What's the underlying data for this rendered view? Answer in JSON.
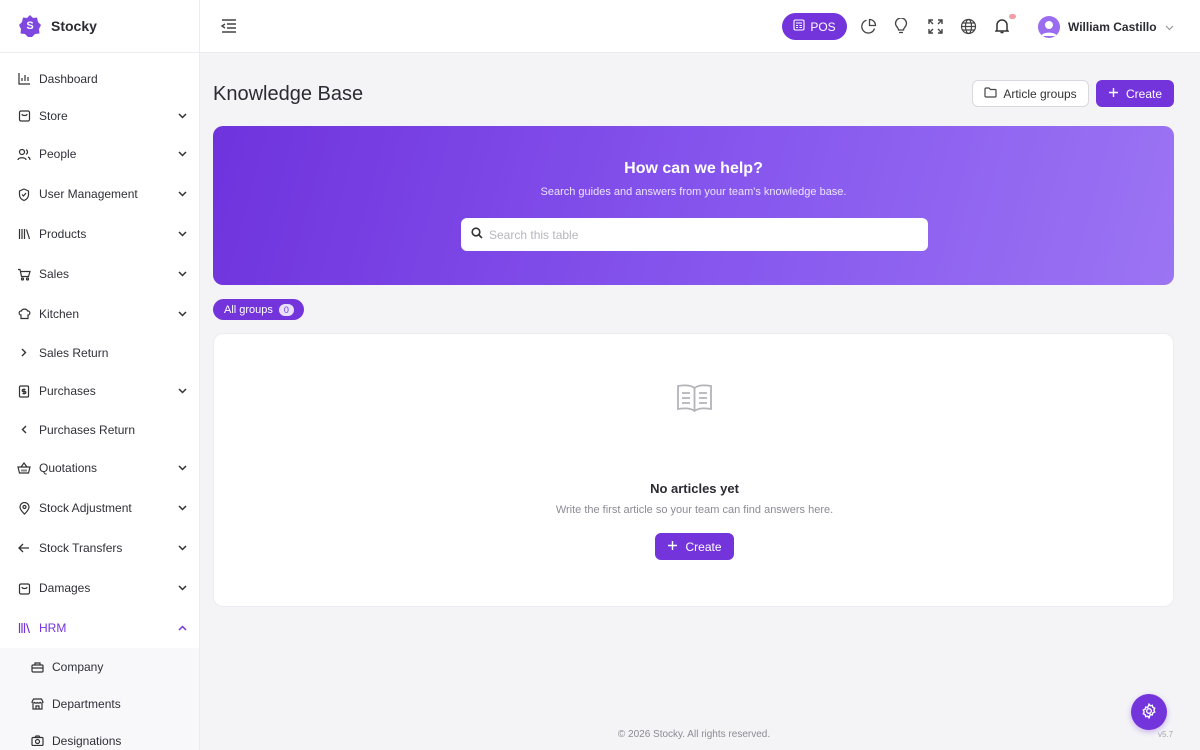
{
  "app": {
    "name": "Stocky",
    "logo_letter": "S"
  },
  "colors": {
    "accent": "#7434db",
    "hero_start": "#6f33dd",
    "hero_end": "#9b74f3"
  },
  "sidebar": {
    "items": [
      {
        "label": "Dashboard",
        "icon": "bar-chart-icon"
      },
      {
        "label": "Store",
        "icon": "shopping-bag-icon"
      },
      {
        "label": "People",
        "icon": "users-icon"
      },
      {
        "label": "User Management",
        "icon": "shield-icon"
      },
      {
        "label": "Products",
        "icon": "books-icon"
      },
      {
        "label": "Sales",
        "icon": "cart-icon"
      },
      {
        "label": "Kitchen",
        "icon": "chef-hat-icon"
      },
      {
        "label": "Sales Return",
        "icon": "chevron-right-icon"
      },
      {
        "label": "Purchases",
        "icon": "receipt-icon"
      },
      {
        "label": "Purchases Return",
        "icon": "chevron-left-icon"
      },
      {
        "label": "Quotations",
        "icon": "basket-icon"
      },
      {
        "label": "Stock Adjustment",
        "icon": "map-pin-icon"
      },
      {
        "label": "Stock Transfers",
        "icon": "arrow-left-icon"
      },
      {
        "label": "Damages",
        "icon": "shopping-bag-icon"
      },
      {
        "label": "HRM",
        "icon": "library-icon"
      }
    ],
    "hrm_sub": [
      {
        "label": "Company",
        "icon": "building-icon"
      },
      {
        "label": "Departments",
        "icon": "store-icon"
      },
      {
        "label": "Designations",
        "icon": "camera-icon"
      }
    ]
  },
  "topbar": {
    "pos_label": "POS",
    "user_name": "William Castillo"
  },
  "main": {
    "title": "Knowledge Base",
    "article_groups_label": "Article groups",
    "create_label": "Create",
    "hero": {
      "title": "How can we help?",
      "subtitle": "Search guides and answers from your team's knowledge base.",
      "search_placeholder": "Search this table"
    },
    "filter_chip": {
      "label": "All groups",
      "count": "0"
    },
    "empty": {
      "title": "No articles yet",
      "subtitle": "Write the first article so your team can find answers here.",
      "button_label": "Create"
    }
  },
  "footer": {
    "copyright": "© 2026 Stocky. All rights reserved.",
    "version": "v5.7"
  }
}
